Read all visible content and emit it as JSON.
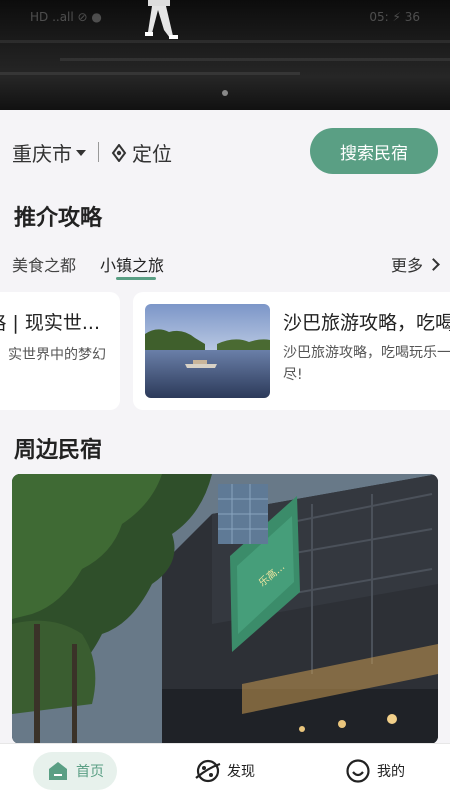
{
  "status_bar": {
    "left": "HD ..all ⊘ ●",
    "right": "05:  ⚡ 36"
  },
  "location": {
    "city": "重庆市",
    "locate_label": "定位",
    "search_button": "搜索民宿"
  },
  "guides": {
    "title": "推介攻略",
    "tabs": [
      {
        "label": "美食之都",
        "active": false
      },
      {
        "label": "小镇之旅",
        "active": true
      }
    ],
    "more": "更多",
    "cards": [
      {
        "title": "咯 | 现实世...",
        "desc": "实世界中的梦幻"
      },
      {
        "title": "沙巴旅游攻略，吃喝",
        "desc": "沙巴旅游攻略，吃喝玩乐一\n尽!"
      }
    ]
  },
  "nearby": {
    "title": "周边民宿",
    "sign_text": "乐高…"
  },
  "bottom_nav": [
    {
      "label": "首页",
      "icon": "home-icon",
      "active": true
    },
    {
      "label": "发现",
      "icon": "planet-icon",
      "active": false
    },
    {
      "label": "我的",
      "icon": "smile-icon",
      "active": false
    }
  ],
  "colors": {
    "accent": "#5a9f84",
    "accent_light": "#e7f1ec",
    "background": "#f5f4f7"
  }
}
